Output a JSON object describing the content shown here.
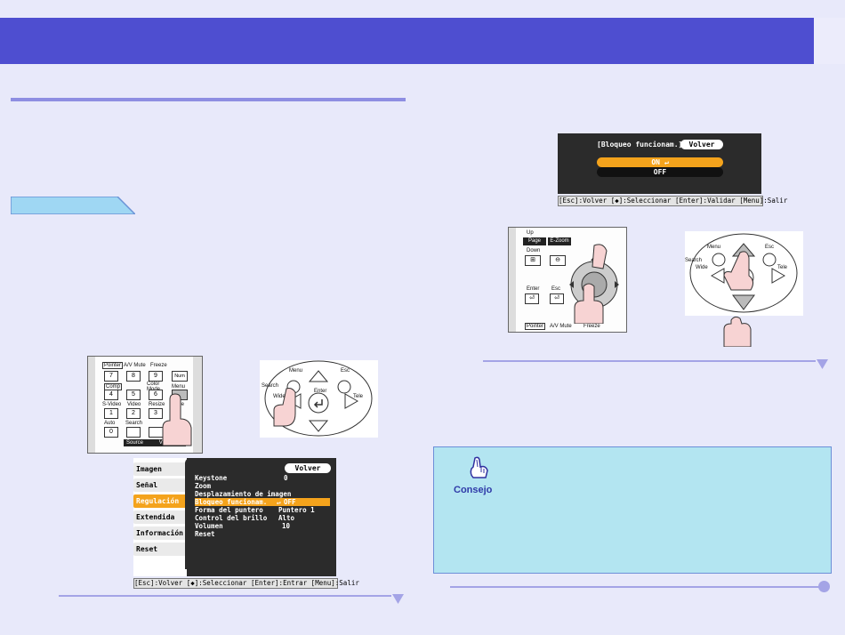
{
  "colors": {
    "header": "#4e4ed0",
    "rule": "#8e8ee2",
    "highlight": "#f4a31c",
    "tip_bg": "#b3e5f1"
  },
  "left_remote": {
    "row1": [
      "Pointer",
      "A/V Mute",
      "Freeze"
    ],
    "row1_keys": [
      "7",
      "8",
      "9",
      "Num"
    ],
    "row2": [
      "Comp",
      "Color Mode",
      "Menu"
    ],
    "row2_keys": [
      "4",
      "5",
      "6"
    ],
    "row3": [
      "S-Video",
      "Video",
      "Resize",
      "Page"
    ],
    "row3_keys": [
      "1",
      "2",
      "3"
    ],
    "row4": [
      "Auto",
      "Search"
    ],
    "row4_keys": [
      "0"
    ],
    "bottom": [
      "Source",
      "Volume"
    ]
  },
  "dial_left": {
    "menu": "Menu",
    "esc": "Esc",
    "enter": "Enter",
    "wide": "Wide",
    "tele": "Tele",
    "search": "Search"
  },
  "settings_menu": {
    "tabs": [
      "Imagen",
      "Señal",
      "Regulación",
      "Extendida",
      "Información",
      "Reset"
    ],
    "active_tab": "Regulación",
    "back": "Volver",
    "rows": [
      {
        "label": "Keystone",
        "value": "0"
      },
      {
        "label": "Zoom",
        "value": ""
      },
      {
        "label": "Desplazamiento de imagen",
        "value": ""
      },
      {
        "label": "Bloqueo funcionam.",
        "value": "OFF"
      },
      {
        "label": "Forma del puntero",
        "value": "Puntero 1"
      },
      {
        "label": "Control del brillo",
        "value": "Alto"
      },
      {
        "label": "Volumen",
        "value": "10"
      },
      {
        "label": "Reset",
        "value": ""
      }
    ],
    "footer": "[Esc]:Volver [◆]:Seleccionar [Enter]:Entrar   [Menu]:Salir"
  },
  "lock_dialog": {
    "title": "[Bloqueo funcionam.]",
    "back": "Volver",
    "options": [
      "ON",
      "OFF"
    ],
    "selected": "ON",
    "footer": "[Esc]:Volver [◆]:Seleccionar [Enter]:Validar   [Menu]:Salir"
  },
  "right_remote": {
    "labels": [
      "Up",
      "Page",
      "Down",
      "E-Zoom",
      "Enter",
      "Esc",
      "Pointer",
      "A/V Mute",
      "Freeze"
    ]
  },
  "dial_right": {
    "menu": "Menu",
    "esc": "Esc",
    "wide": "Wide",
    "tele": "Tele",
    "search": "Search"
  },
  "tip": {
    "label": "Consejo"
  }
}
